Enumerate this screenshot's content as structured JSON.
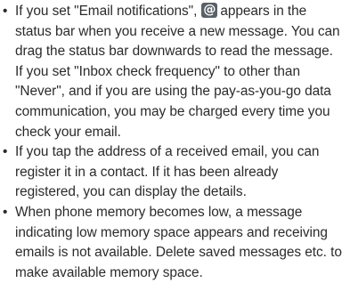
{
  "bullet_symbol": "•",
  "icons": {
    "email_notification_icon": "email-at-icon"
  },
  "bullets": [
    {
      "before_icon": "If you set \"Email notifications\",",
      "after_icon": "appears in the status bar when you receive a new message. You can drag the status bar downwards to read the message. If you set \"Inbox check frequency\" to other than \"Never\", and if you are using the pay-as-you-go data communication, you may be charged every time you check your email."
    },
    {
      "text": "If you tap the address of a received email, you can register it in a contact. If it has been already registered, you can display the details."
    },
    {
      "text": "When phone memory becomes low, a message indicating low memory space appears and receiving emails is not available. Delete saved messages etc. to make available memory space."
    }
  ]
}
